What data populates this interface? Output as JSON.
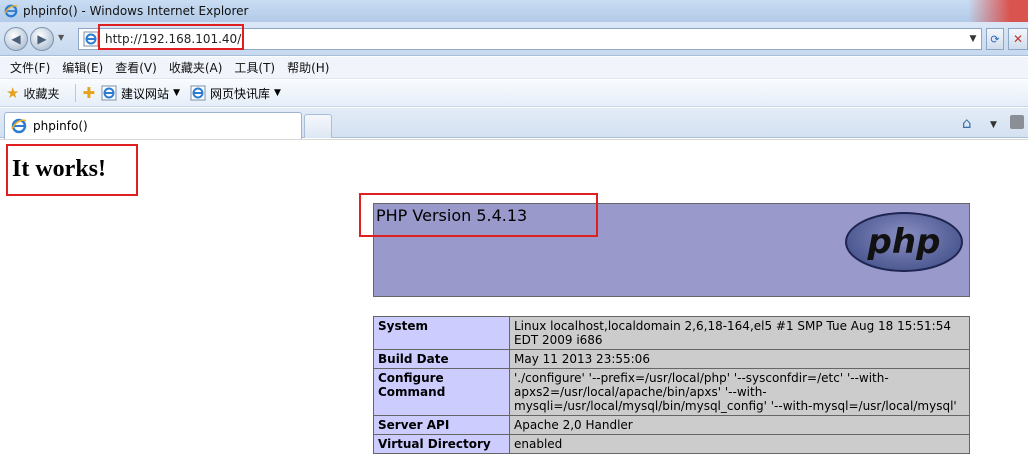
{
  "window": {
    "title": "phpinfo() - Windows Internet Explorer"
  },
  "address": {
    "url": "http://192.168.101.40/"
  },
  "menu": [
    "文件(F)",
    "编辑(E)",
    "查看(V)",
    "收藏夹(A)",
    "工具(T)",
    "帮助(H)"
  ],
  "favorites": {
    "label": "收藏夹",
    "links": [
      "建议网站",
      "网页快讯库"
    ]
  },
  "tab": {
    "title": "phpinfo()"
  },
  "page": {
    "heading": "It works!",
    "php_version": "PHP Version 5.4.13",
    "logo_text": "php",
    "rows": [
      {
        "key": "System",
        "value": "Linux localhost,localdomain 2,6,18-164,el5 #1 SMP Tue Aug 18 15:51:54 EDT 2009 i686"
      },
      {
        "key": "Build Date",
        "value": "May 11 2013 23:55:06"
      },
      {
        "key": "Configure Command",
        "value": "'./configure' '--prefix=/usr/local/php' '--sysconfdir=/etc' '--with-apxs2=/usr/local/apache/bin/apxs' '--with-mysqli=/usr/local/mysql/bin/mysql_config' '--with-mysql=/usr/local/mysql'"
      },
      {
        "key": "Server API",
        "value": "Apache 2,0 Handler"
      },
      {
        "key": "Virtual Directory",
        "value": "enabled"
      }
    ]
  },
  "colors": {
    "php_header": "#9999cc",
    "key_cell": "#ccccff",
    "value_cell": "#cccccc",
    "highlight": "#e02020"
  }
}
